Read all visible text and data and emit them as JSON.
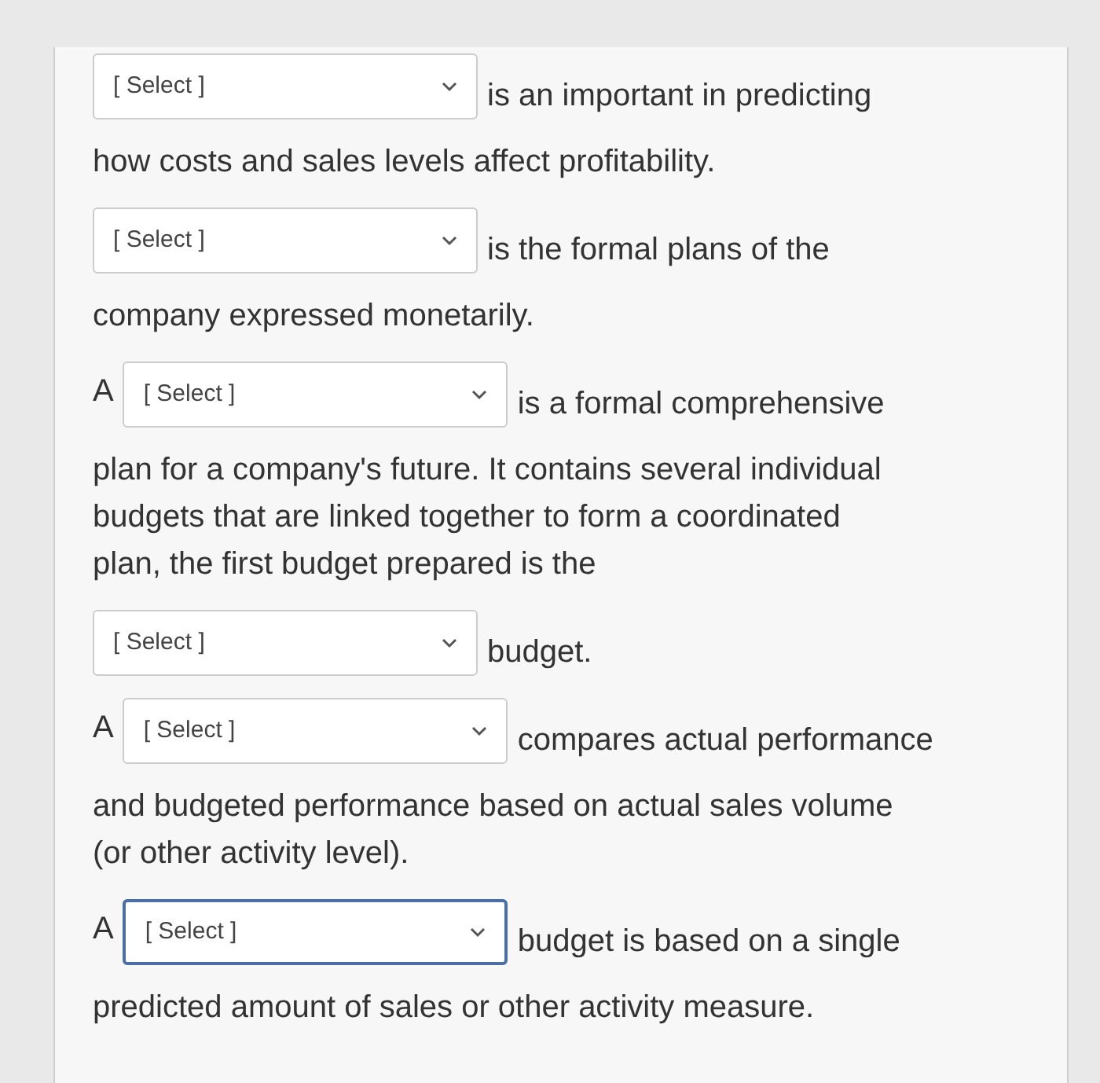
{
  "blocks": [
    {
      "kind": "select",
      "placeholder": "[ Select ]",
      "focused": false,
      "after": "is an important in predicting"
    },
    {
      "kind": "text",
      "text": "how costs and sales levels affect profitability."
    },
    {
      "kind": "select",
      "placeholder": "[ Select ]",
      "focused": false,
      "after": "is the formal plans of the"
    },
    {
      "kind": "text",
      "text": "company expressed monetarily."
    },
    {
      "kind": "select",
      "prefix": "A",
      "placeholder": "[ Select ]",
      "focused": false,
      "after": "is a formal comprehensive"
    },
    {
      "kind": "text",
      "text": "plan for a company's future. It contains several individual budgets that are linked together to form a coordinated plan, the first budget prepared is the"
    },
    {
      "kind": "select",
      "placeholder": "[ Select ]",
      "focused": false,
      "after": "budget."
    },
    {
      "kind": "select",
      "prefix": "A",
      "placeholder": "[ Select ]",
      "focused": false,
      "after": "compares actual performance"
    },
    {
      "kind": "text",
      "text": "and budgeted performance based on actual sales volume (or other activity level)."
    },
    {
      "kind": "select",
      "prefix": "A",
      "placeholder": "[ Select ]",
      "focused": true,
      "after": "budget is based on a single"
    },
    {
      "kind": "text",
      "text": "predicted amount of sales or other activity measure."
    }
  ]
}
